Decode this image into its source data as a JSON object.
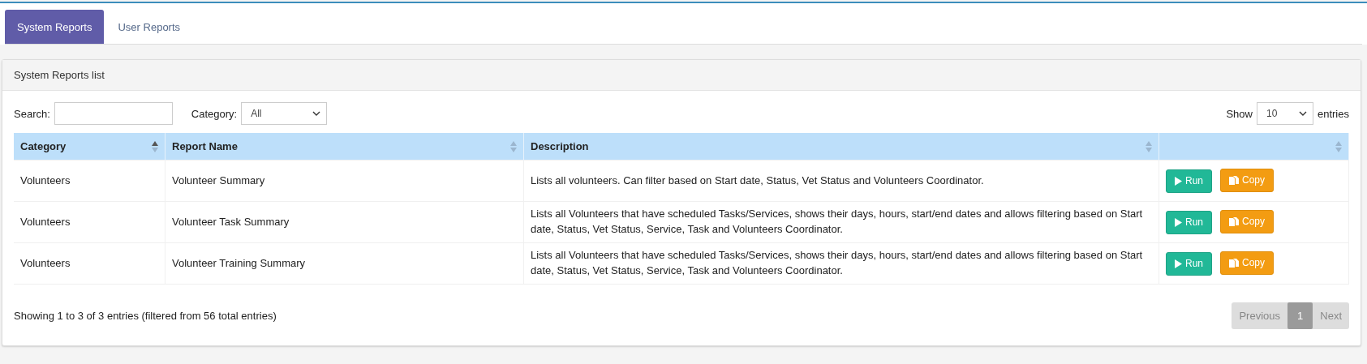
{
  "tabs": [
    {
      "label": "System Reports",
      "selected": true
    },
    {
      "label": "User Reports",
      "selected": false
    }
  ],
  "panel": {
    "title": "System Reports list"
  },
  "filters": {
    "search_label": "Search:",
    "category_label": "Category:",
    "category_value": "All",
    "show_label": "Show",
    "show_value": "10",
    "entries_label": "entries"
  },
  "table": {
    "columns": [
      {
        "label": "Category",
        "sorted": true
      },
      {
        "label": "Report Name",
        "sorted": false
      },
      {
        "label": "Description",
        "sorted": false
      },
      {
        "sorted": false
      }
    ],
    "rows": [
      {
        "category": "Volunteers",
        "name": "Volunteer Summary",
        "description": "Lists all volunteers. Can filter based on Start date, Status, Vet Status and Volunteers Coordinator.",
        "run": "Run",
        "copy": "Copy"
      },
      {
        "category": "Volunteers",
        "name": "Volunteer Task Summary",
        "description": "Lists all Volunteers that have scheduled Tasks/Services, shows their days, hours, start/end dates and allows filtering based on Start date, Status, Vet Status, Service, Task and Volunteers Coordinator.",
        "run": "Run",
        "copy": "Copy"
      },
      {
        "category": "Volunteers",
        "name": "Volunteer Training Summary",
        "description": "Lists all Volunteers that have scheduled Tasks/Services, shows their days, hours, start/end dates and allows filtering based on Start date, Status, Vet Status, Service, Task and Volunteers Coordinator.",
        "run": "Run",
        "copy": "Copy"
      }
    ]
  },
  "footer": {
    "info": "Showing 1 to 3 of 3 entries (filtered from 56 total entries)",
    "pagination": [
      {
        "label": "Previous",
        "kind": "nav",
        "disabled": true,
        "selected": false
      },
      {
        "label": "1",
        "kind": "page",
        "disabled": false,
        "selected": true
      },
      {
        "label": "Next",
        "kind": "nav",
        "disabled": true,
        "selected": false
      }
    ]
  }
}
